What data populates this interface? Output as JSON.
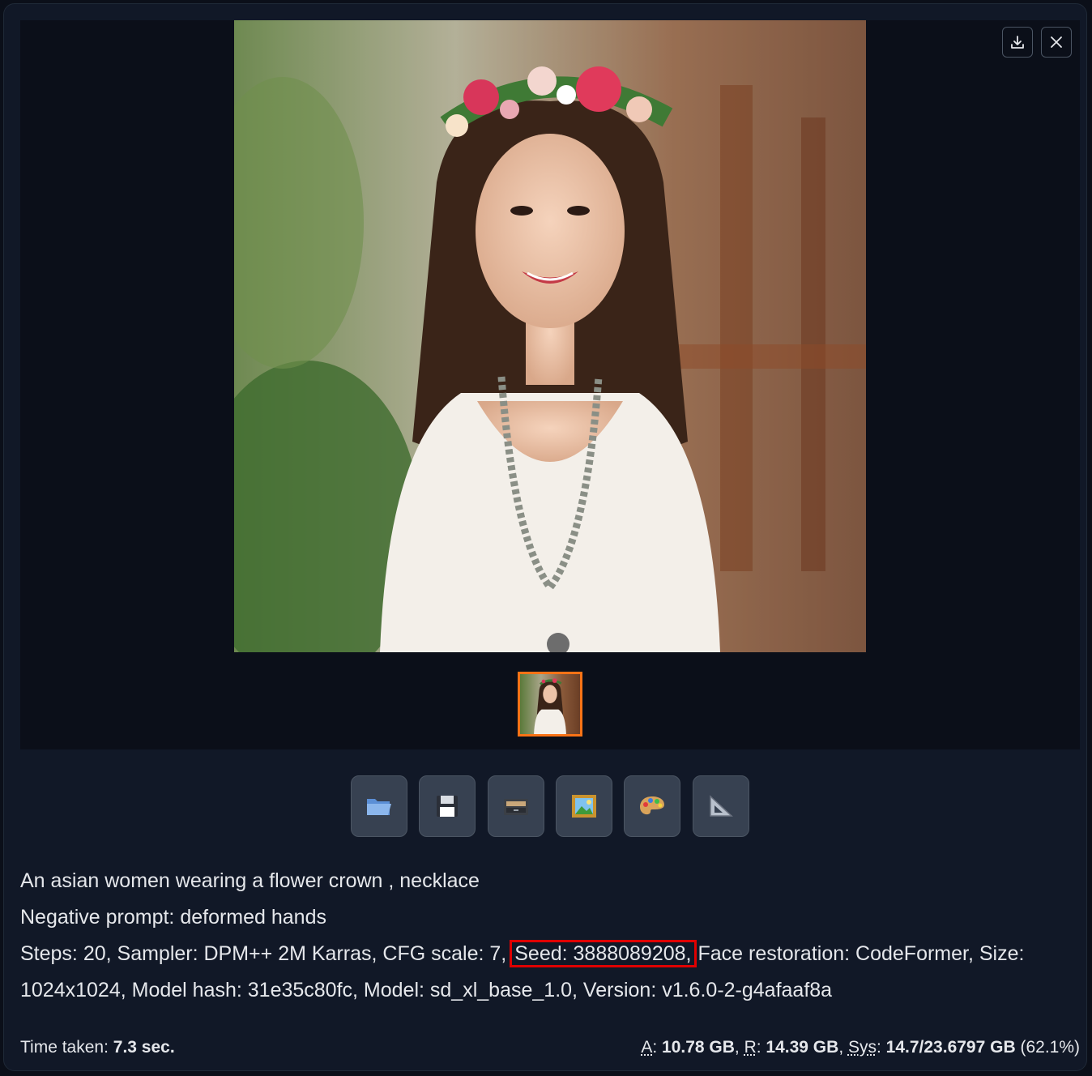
{
  "gallery": {
    "download_icon": "download-icon",
    "close_icon": "close-icon",
    "main_image_alt": "generated image",
    "thumbnail_alt": "thumbnail"
  },
  "toolbar": {
    "buttons": [
      {
        "name": "open-folder-button",
        "icon": "folder-icon"
      },
      {
        "name": "save-button",
        "icon": "floppy-disk-icon"
      },
      {
        "name": "zip-button",
        "icon": "file-cabinet-icon"
      },
      {
        "name": "send-to-img2img-button",
        "icon": "framed-picture-icon"
      },
      {
        "name": "send-to-inpaint-button",
        "icon": "palette-icon"
      },
      {
        "name": "send-to-extras-button",
        "icon": "triangle-ruler-icon"
      }
    ]
  },
  "info": {
    "prompt": "An asian women wearing a flower crown , necklace",
    "negative_prompt": "Negative prompt: deformed hands",
    "params_before_seed": "Steps: 20, Sampler: DPM++ 2M Karras, CFG scale: 7,",
    "seed": "Seed: 3888089208,",
    "params_after_seed": "Face restoration: CodeFormer, Size: 1024x1024, Model hash: 31e35c80fc, Model: sd_xl_base_1.0, Version: v1.6.0-2-g4afaaf8a"
  },
  "footer": {
    "time_label": "Time taken:",
    "time_value": "7.3 sec.",
    "a_label": "A",
    "a_value": "10.78 GB",
    "r_label": "R",
    "r_value": "14.39 GB",
    "sys_label": "Sys",
    "sys_value": "14.7/23.6797 GB",
    "sys_pct": "(62.1%)"
  },
  "colors": {
    "background": "#0b0f19",
    "panel": "#111827",
    "thumb_border": "#f97316",
    "seed_highlight": "#e00000"
  }
}
